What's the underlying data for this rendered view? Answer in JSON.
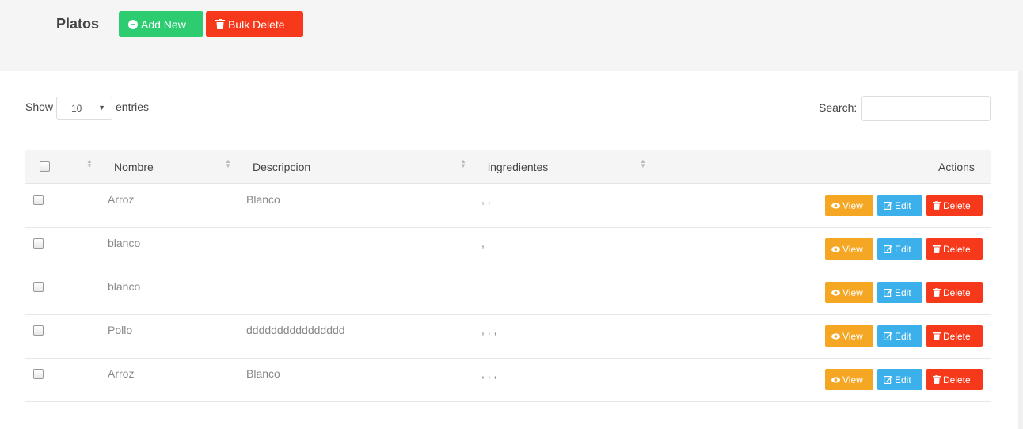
{
  "header": {
    "title": "Platos",
    "add_new_label": "Add New",
    "bulk_delete_label": "Bulk Delete"
  },
  "table_controls": {
    "show_label": "Show",
    "page_length": "10",
    "entries_label": "entries",
    "search_label": "Search:",
    "search_value": ""
  },
  "table": {
    "columns": [
      "Nombre",
      "Descripcion",
      "ingredientes",
      "Actions"
    ],
    "rows": [
      {
        "nombre": "Arroz",
        "descripcion": "Blanco",
        "ingredientes": ", ,"
      },
      {
        "nombre": "blanco",
        "descripcion": "",
        "ingredientes": ","
      },
      {
        "nombre": "blanco",
        "descripcion": "",
        "ingredientes": ""
      },
      {
        "nombre": "Pollo",
        "descripcion": "dddddddddddddddd",
        "ingredientes": ", , ,"
      },
      {
        "nombre": "Arroz",
        "descripcion": "Blanco",
        "ingredientes": ", , ,"
      }
    ],
    "actions": {
      "view": "View",
      "edit": "Edit",
      "delete": "Delete"
    }
  },
  "icons": {
    "add": "plus-circle-icon",
    "trash": "trash-icon",
    "eye": "eye-icon",
    "edit": "edit-icon",
    "sort": "sort-icon"
  },
  "colors": {
    "add_button": "#2ecc71",
    "delete_button": "#f6391a",
    "view_button": "#f5a623",
    "edit_button": "#3bb0ea"
  }
}
